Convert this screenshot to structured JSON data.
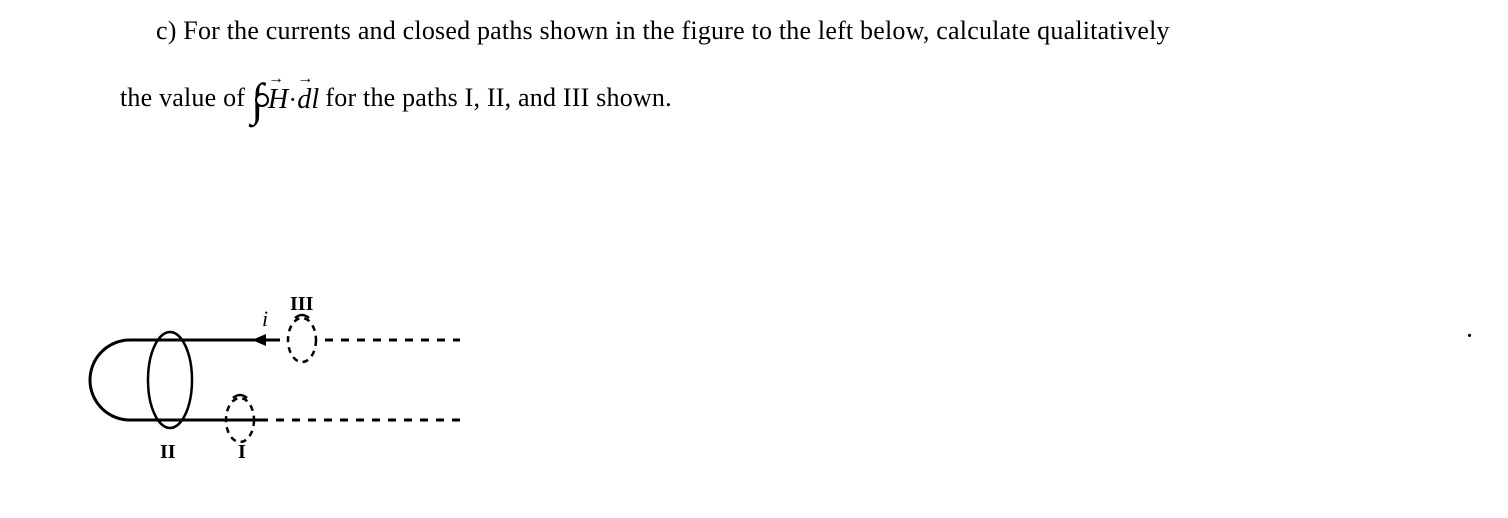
{
  "problem": {
    "line1": "c) For the currents and closed paths shown in the figure to the left below, calculate qualitatively",
    "line2_pre": "the value of ",
    "integral_expr_H": "H",
    "integral_dot": " · ",
    "integral_expr_dl": "dl",
    "line2_post": "  for the paths I, II, and III shown."
  },
  "figure": {
    "label_i": "i",
    "label_I": "I",
    "label_II": "II",
    "label_III": "III"
  }
}
